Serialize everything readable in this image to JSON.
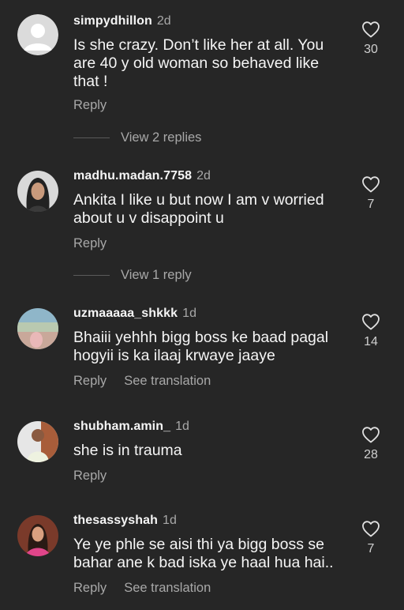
{
  "comments": [
    {
      "username": "simpydhillon",
      "time": "2d",
      "text": "Is she crazy. Don’t like her at all. You are 40 y old woman so behaved like that !",
      "reply_label": "Reply",
      "likes": "30",
      "view_replies": "View 2 replies",
      "avatar": "default-avatar"
    },
    {
      "username": "madhu.madan.7758",
      "time": "2d",
      "text": "Ankita I like u but now I am v worried about u  v disappoint u",
      "reply_label": "Reply",
      "likes": "7",
      "view_replies": "View 1 reply",
      "avatar": "woman-portrait"
    },
    {
      "username": "uzmaaaaa_shkkk",
      "time": "1d",
      "text": "Bhaiii yehhh bigg boss ke baad pagal hogyii is ka ilaaj krwaye jaaye",
      "reply_label": "Reply",
      "translate_label": "See translation",
      "likes": "14",
      "avatar": "landscape-photo"
    },
    {
      "username": "shubham.amin_",
      "time": "1d",
      "text": "she is in trauma",
      "reply_label": "Reply",
      "likes": "28",
      "avatar": "man-photo"
    },
    {
      "username": "thesassyshah",
      "time": "1d",
      "text": "Ye ye phle se aisi thi ya bigg boss se bahar ane k bad iska ye haal hua hai..",
      "reply_label": "Reply",
      "translate_label": "See translation",
      "likes": "7",
      "avatar": "woman-pink-photo"
    }
  ],
  "colors": {
    "background": "#262626",
    "primary_text": "#f5f5f5",
    "secondary_text": "#a8a8a8"
  },
  "icons": {
    "like": "heart-outline-icon"
  }
}
